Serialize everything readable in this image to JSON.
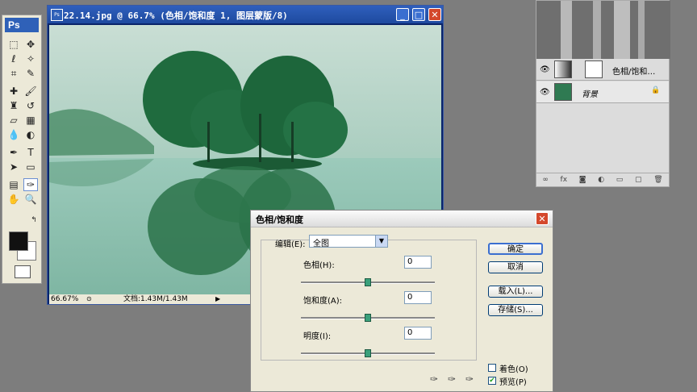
{
  "document": {
    "title": "22.14.jpg @ 66.7% (色相/饱和度 1, 图层蒙版/8)",
    "zoom": "66.67%",
    "doc_info": "文档:1.43M/1.43M",
    "app_badge": "Ps"
  },
  "toolbox": {
    "logo": "Ps"
  },
  "layers": {
    "items": [
      {
        "name": "色相/饱和…"
      },
      {
        "name": "背景"
      }
    ],
    "footer_icons": [
      "link-icon",
      "fx-icon",
      "mask-icon",
      "adjustment-icon",
      "folder-icon",
      "new-layer-icon",
      "trash-icon"
    ]
  },
  "dialog": {
    "title": "色相/饱和度",
    "edit_label": "编辑(E):",
    "edit_value": "全图",
    "hue_label": "色相(H):",
    "hue_value": "0",
    "saturation_label": "饱和度(A):",
    "saturation_value": "0",
    "lightness_label": "明度(I):",
    "lightness_value": "0",
    "ok": "确定",
    "cancel": "取消",
    "load": "载入(L)...",
    "save": "存储(S)...",
    "colorize": "着色(O)",
    "preview": "预览(P)",
    "colorize_checked": false,
    "preview_checked": true,
    "slider_levels": {
      "hue": 0.5,
      "saturation": 0.5,
      "lightness": 0.5
    }
  },
  "colors": {
    "titlebar": "#2f5fbd",
    "canvas_sky": "#cfe3d9",
    "canvas_water": "#8dbfae",
    "tree": "#1f6b3e",
    "slider_knob": "#3aa07b"
  }
}
